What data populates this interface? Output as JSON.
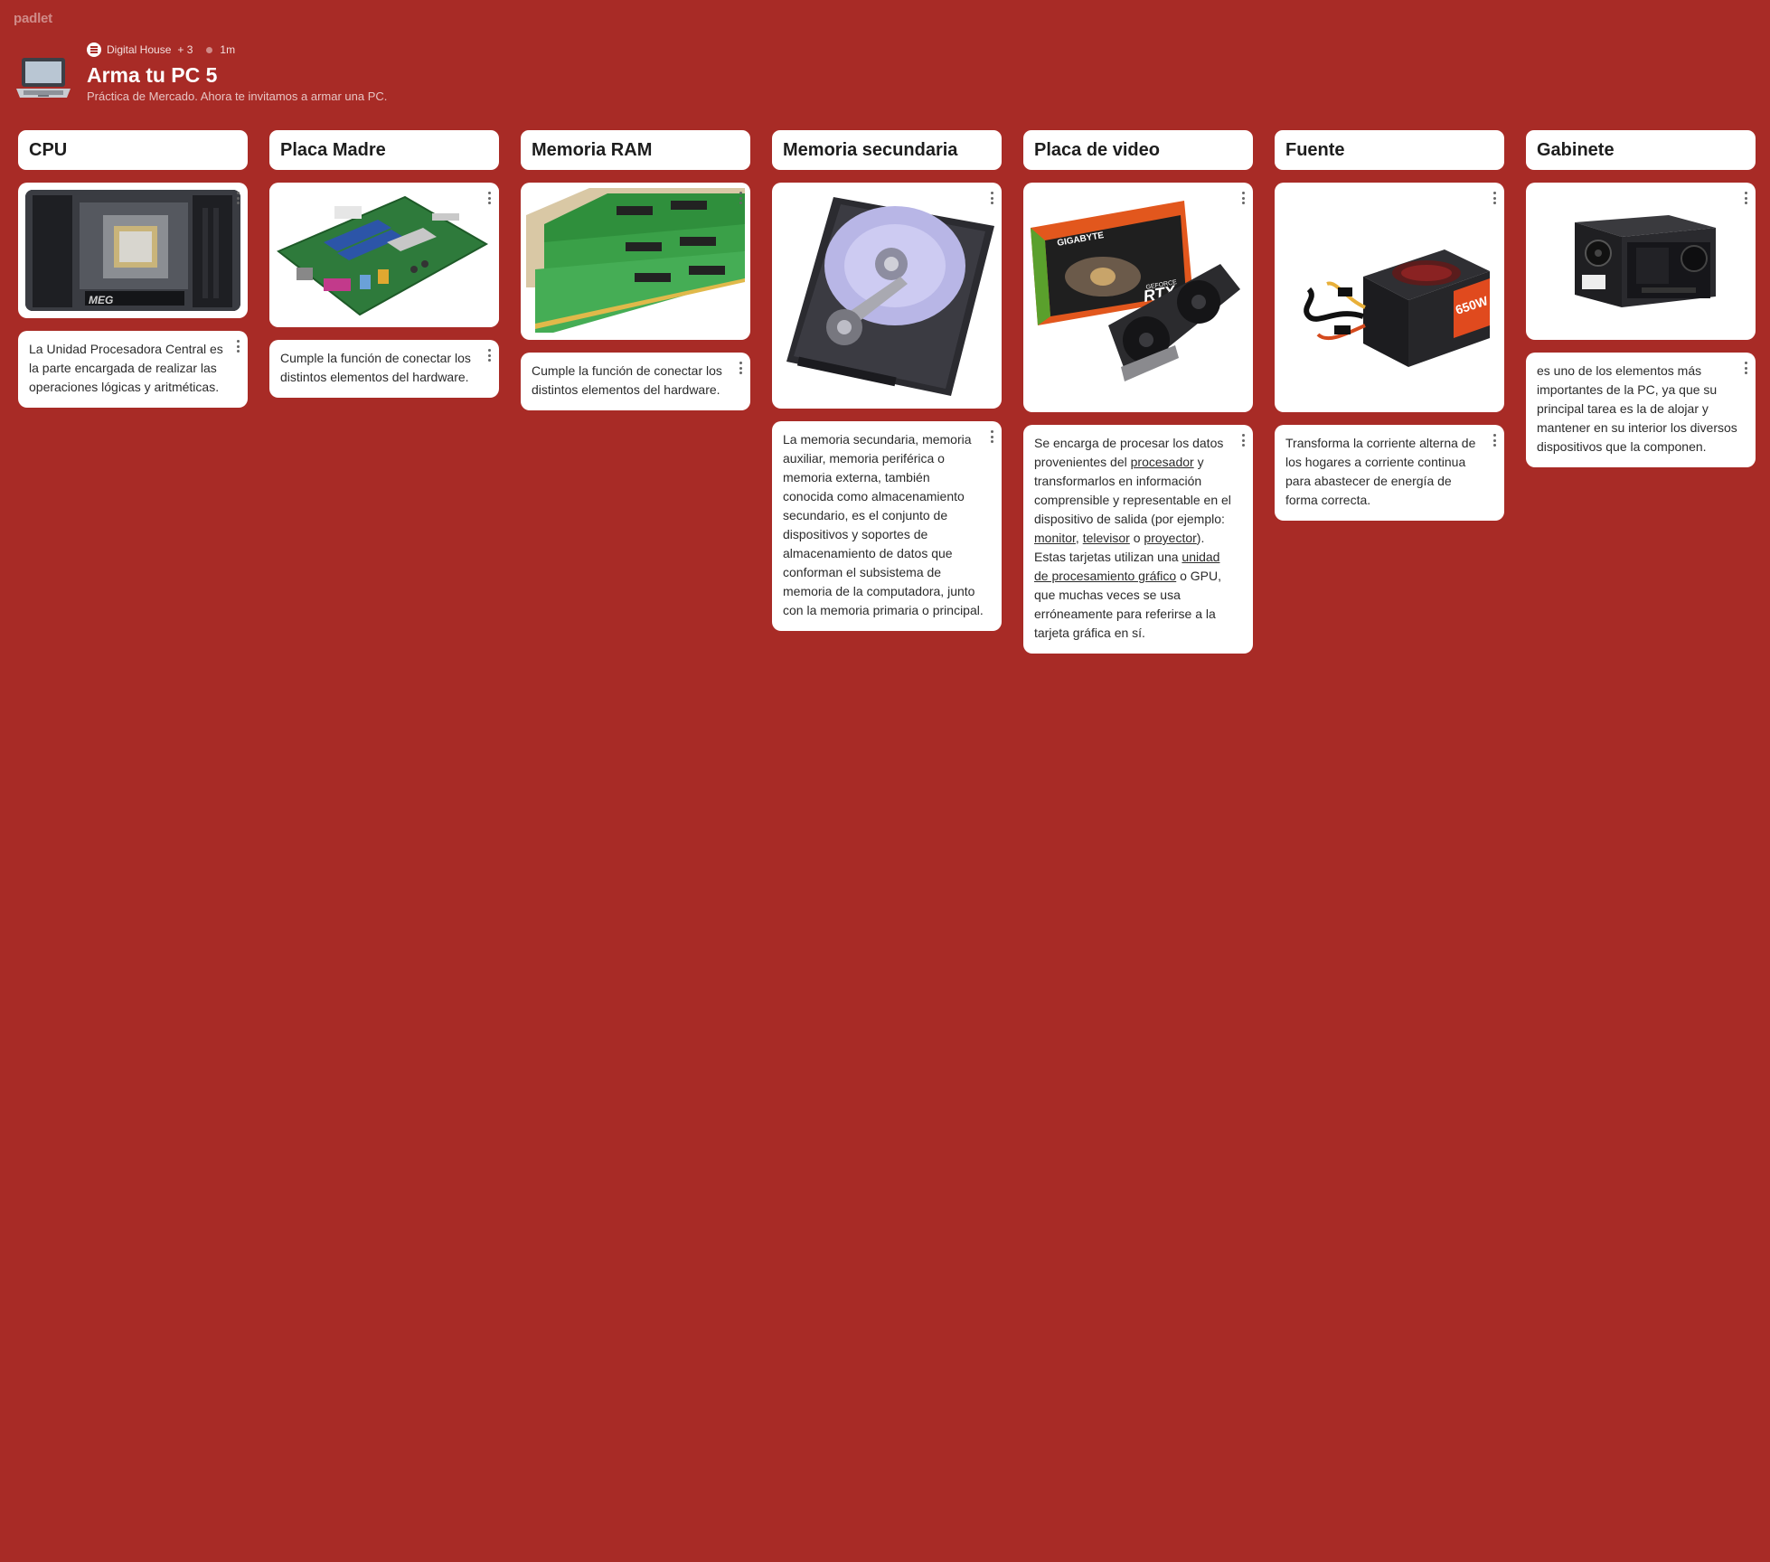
{
  "brand": "padlet",
  "header": {
    "owner": "Digital House",
    "contributors": "+ 3",
    "time": "1m",
    "title": "Arma tu PC 5",
    "subtitle": "Práctica de Mercado. Ahora te invitamos a armar una PC.",
    "icon": "laptop-icon"
  },
  "columns": [
    {
      "name": "CPU",
      "image": "cpu-motherboard-photo",
      "text": "La Unidad Procesadora Central es la parte encargada de realizar las operaciones lógicas y aritméticas."
    },
    {
      "name": "Placa Madre",
      "image": "motherboard-photo",
      "text": "Cumple la función de conectar los distintos elementos del hardware."
    },
    {
      "name": "Memoria RAM",
      "image": "ram-modules-photo",
      "text": "Cumple la función de conectar los distintos elementos del hardware."
    },
    {
      "name": "Memoria secundaria",
      "image": "hard-drive-photo",
      "text": "La memoria secundaria, memoria auxiliar, memoria periférica o memoria externa, también conocida como almacenamiento secundario, es el conjunto de dispositivos y soportes de almacenamiento de datos que conforman el subsistema de memoria de la computadora, junto con la memoria primaria o principal."
    },
    {
      "name": "Placa de video",
      "image": "graphics-card-photo",
      "text_parts": {
        "p1": "Se encarga de procesar los datos provenientes del ",
        "link1": "procesador",
        "p2": " y transformarlos en información comprensible y representable en el dispositivo de salida (por ejemplo: ",
        "link2": "monitor",
        "p3": ", ",
        "link3": "televisor",
        "p4": " o ",
        "link4": "proyector",
        "p5": "). Estas tarjetas utilizan una ",
        "link5": "unidad de procesamiento gráfico",
        "p6": " o GPU, que muchas veces se usa erróneamente para referirse a la tarjeta gráfica en sí."
      },
      "gpu_box_brand": "GIGABYTE",
      "gpu_box_model": "RTX",
      "gpu_box_line": "GEFORCE"
    },
    {
      "name": "Fuente",
      "image": "power-supply-photo",
      "psu_label": "650W",
      "text": "Transforma la corriente alterna de los hogares a corriente continua para abastecer de energía de forma correcta."
    },
    {
      "name": "Gabinete",
      "image": "pc-case-photo",
      "text": "es uno de los elementos más importantes de la PC, ya que su principal tarea es la de alojar y mantener en su interior los diversos dispositivos que la componen."
    }
  ]
}
